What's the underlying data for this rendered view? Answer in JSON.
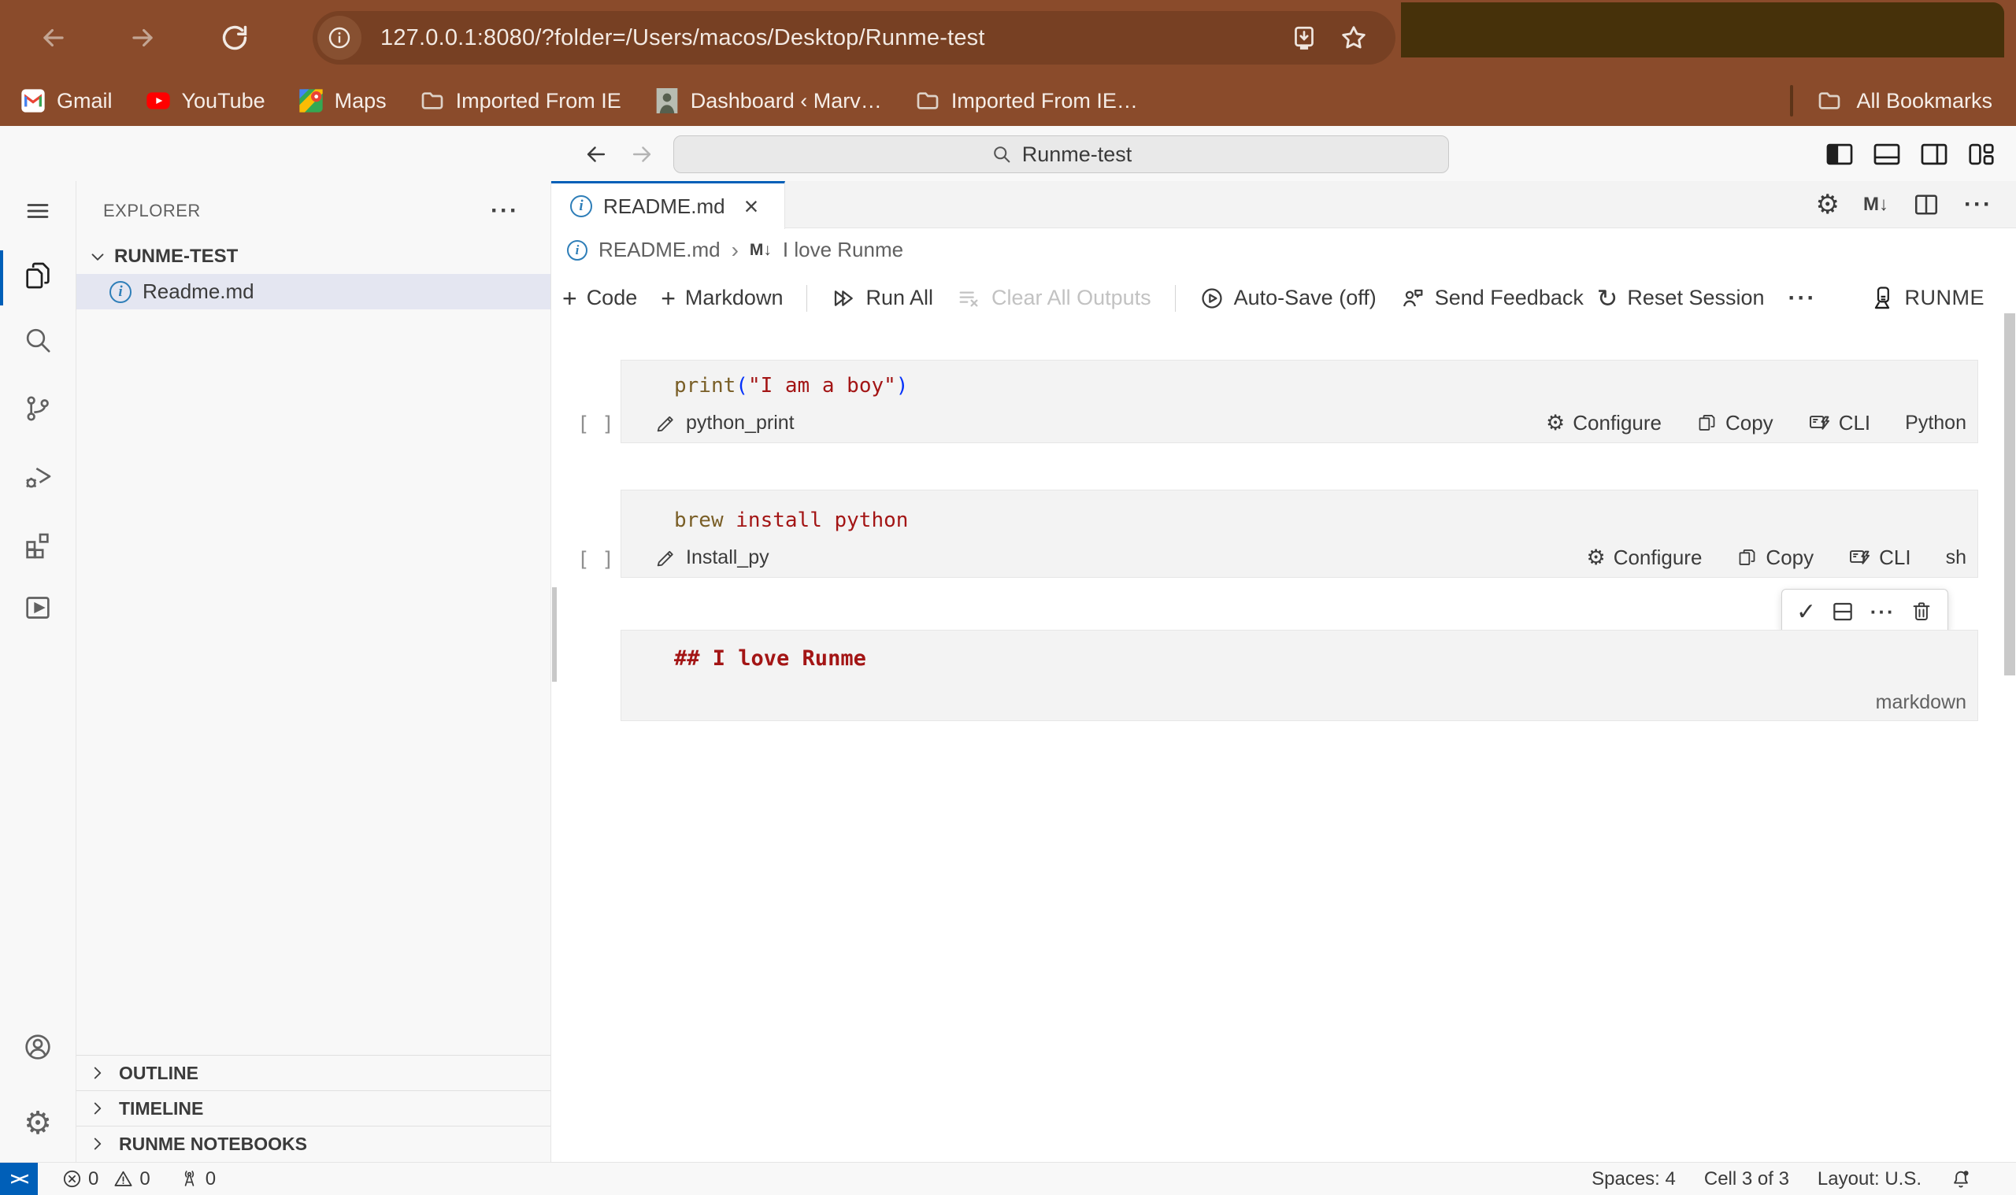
{
  "browser": {
    "url": "127.0.0.1:8080/?folder=/Users/macos/Desktop/Runme-test",
    "bookmarks": [
      {
        "label": "Gmail"
      },
      {
        "label": "YouTube"
      },
      {
        "label": "Maps"
      },
      {
        "label": "Imported From IE"
      },
      {
        "label": "Dashboard ‹ Marv…"
      },
      {
        "label": "Imported From IE…"
      }
    ],
    "all_bookmarks_label": "All Bookmarks"
  },
  "titlebar": {
    "search_value": "Runme-test"
  },
  "sidebar": {
    "header": "EXPLORER",
    "root_folder": "RUNME-TEST",
    "file_name": "Readme.md",
    "sections": {
      "outline": "OUTLINE",
      "timeline": "TIMELINE",
      "runme_notebooks": "RUNME NOTEBOOKS"
    }
  },
  "editor": {
    "tab_title": "README.md",
    "breadcrumb": {
      "file": "README.md",
      "heading": "I love Runme"
    },
    "toolbar": {
      "add_code": "Code",
      "add_markdown": "Markdown",
      "run_all": "Run All",
      "clear_all": "Clear All Outputs",
      "auto_save": "Auto-Save (off)",
      "send_feedback": "Send Feedback",
      "reset_session": "Reset Session",
      "brand": "RUNME"
    },
    "cell_actions": {
      "configure": "Configure",
      "copy": "Copy",
      "cli": "CLI"
    },
    "cells": [
      {
        "type": "code",
        "exec": "[ ]",
        "name": "python_print",
        "lang": "Python",
        "tokens": [
          {
            "text": "print",
            "style": "func"
          },
          {
            "text": "(",
            "style": "bracket"
          },
          {
            "text": "\"I am a boy\"",
            "style": "string"
          },
          {
            "text": ")",
            "style": "bracket"
          }
        ]
      },
      {
        "type": "code",
        "exec": "[ ]",
        "name": "Install_py",
        "lang": "sh",
        "tokens": [
          {
            "text": "brew",
            "style": "func"
          },
          {
            "text": " install python",
            "style": "string"
          }
        ]
      },
      {
        "type": "markdown",
        "text": "## I love Runme",
        "lang": "markdown"
      }
    ]
  },
  "statusbar": {
    "errors": "0",
    "warnings": "0",
    "ports": "0",
    "spaces": "Spaces: 4",
    "cell_position": "Cell 3 of 3",
    "layout": "Layout: U.S."
  },
  "glyphs": {
    "gear": "⚙",
    "reset": "↻",
    "check": "✓",
    "close": "×",
    "more": "···",
    "md_badge": "M↓",
    "remote": "><",
    "plus": "+"
  },
  "colors": {
    "accent_blue": "#005fb8",
    "chrome_brown": "#8a4b2b",
    "string_red": "#a31515",
    "func_olive": "#795e26",
    "bracket_blue": "#0431fa",
    "info_blue": "#2e7eb8",
    "selection": "#e4e6f1"
  }
}
